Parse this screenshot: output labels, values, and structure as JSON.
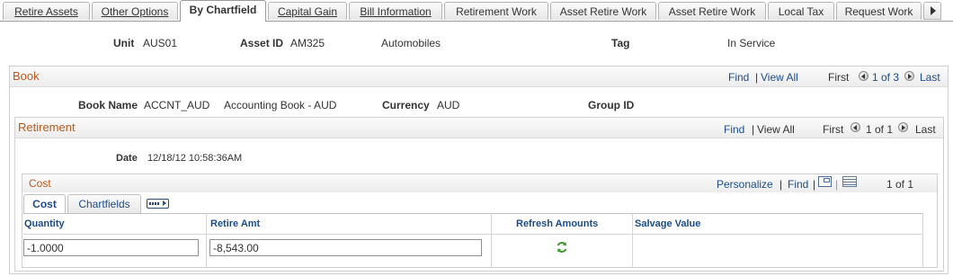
{
  "tabs": [
    {
      "label": "Retire Assets"
    },
    {
      "label": "Other Options"
    },
    {
      "label": "By Chartfield"
    },
    {
      "label": "Capital Gain"
    },
    {
      "label": "Bill Information"
    },
    {
      "label": "Retirement Work"
    },
    {
      "label": "Asset Retire Work"
    },
    {
      "label": "Asset Retire Work"
    },
    {
      "label": "Local Tax"
    },
    {
      "label": "Request Work"
    }
  ],
  "summary": {
    "unit_label": "Unit",
    "unit_value": "AUS01",
    "asset_id_label": "Asset ID",
    "asset_id_value": "AM325",
    "asset_desc": "Automobiles",
    "tag_label": "Tag",
    "status": "In Service"
  },
  "book": {
    "title": "Book",
    "find": "Find",
    "sep": "|",
    "view_all": "View All",
    "first": "First",
    "pager": "1 of 3",
    "last": "Last",
    "book_name_label": "Book Name",
    "book_name_value": "ACCNT_AUD",
    "book_desc": "Accounting Book - AUD",
    "currency_label": "Currency",
    "currency_value": "AUD",
    "group_id_label": "Group ID"
  },
  "retirement": {
    "title": "Retirement",
    "find": "Find",
    "sep": "|",
    "view_all": "View All",
    "first": "First",
    "pager": "1 of 1",
    "last": "Last",
    "date_label": "Date",
    "date_value": "12/18/12 10:58:36AM"
  },
  "cost": {
    "title": "Cost",
    "personalize": "Personalize",
    "sep": "|",
    "find": "Find",
    "sep2": "|",
    "pager": "1 of 1",
    "subtabs": [
      {
        "label": "Cost"
      },
      {
        "label": "Chartfields"
      }
    ],
    "columns": {
      "quantity": "Quantity",
      "retire_amt": "Retire Amt",
      "refresh": "Refresh Amounts",
      "salvage": "Salvage Value"
    },
    "row": {
      "quantity": "-1.0000",
      "retire_amt": "-8,543.00"
    }
  }
}
